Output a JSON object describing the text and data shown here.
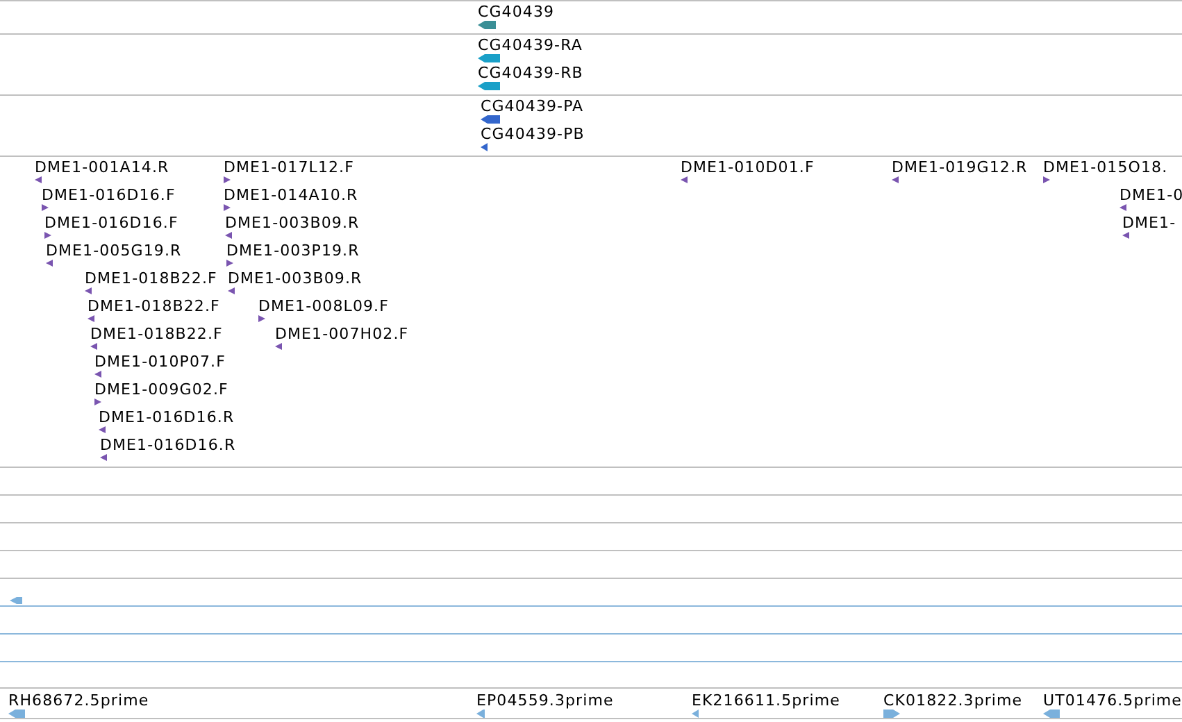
{
  "tracks": [
    {
      "kind": "gene",
      "features": [
        {
          "label": "CG40439",
          "reverse": true
        }
      ]
    },
    {
      "kind": "transcript",
      "features": [
        {
          "label": "CG40439-RA",
          "reverse": true
        },
        {
          "label": "CG40439-RB",
          "reverse": true
        }
      ]
    },
    {
      "kind": "protein",
      "features": [
        {
          "label": "CG40439-PA",
          "reverse": true
        },
        {
          "label": "CG40439-PB",
          "reverse": true
        }
      ]
    },
    {
      "kind": "insertion",
      "features": [
        {
          "label": "DME1-001A14.R",
          "reverse": true
        },
        {
          "label": "DME1-016D16.F",
          "reverse": false
        },
        {
          "label": "DME1-016D16.F",
          "reverse": false
        },
        {
          "label": "DME1-005G19.R",
          "reverse": true
        },
        {
          "label": "DME1-018B22.F",
          "reverse": true
        },
        {
          "label": "DME1-018B22.F",
          "reverse": true
        },
        {
          "label": "DME1-018B22.F",
          "reverse": true
        },
        {
          "label": "DME1-010P07.F",
          "reverse": true
        },
        {
          "label": "DME1-009G02.F",
          "reverse": false
        },
        {
          "label": "DME1-016D16.R",
          "reverse": true
        },
        {
          "label": "DME1-016D16.R",
          "reverse": true
        },
        {
          "label": "DME1-017L12.F",
          "reverse": false
        },
        {
          "label": "DME1-014A10.R",
          "reverse": false
        },
        {
          "label": "DME1-003B09.R",
          "reverse": true
        },
        {
          "label": "DME1-003P19.R",
          "reverse": false
        },
        {
          "label": "DME1-003B09.R",
          "reverse": true
        },
        {
          "label": "DME1-008L09.F",
          "reverse": false
        },
        {
          "label": "DME1-007H02.F",
          "reverse": true
        },
        {
          "label": "DME1-010D01.F",
          "reverse": true
        },
        {
          "label": "DME1-019G12.R",
          "reverse": true
        },
        {
          "label": "DME1-015O18.",
          "reverse": false
        },
        {
          "label": "DME1-0",
          "reverse": true
        },
        {
          "label": "DME1-",
          "reverse": true
        }
      ]
    },
    {
      "kind": "subtracks",
      "features": [
        {
          "reverse": true
        }
      ]
    },
    {
      "kind": "est",
      "features": [
        {
          "label": "RH68672.5prime",
          "reverse": true
        },
        {
          "label": "EP04559.3prime",
          "reverse": true
        },
        {
          "label": "EK216611.5prime",
          "reverse": true
        },
        {
          "label": "CK01822.3prime",
          "reverse": false
        },
        {
          "label": "UT01476.5prime",
          "reverse": true
        }
      ]
    }
  ]
}
